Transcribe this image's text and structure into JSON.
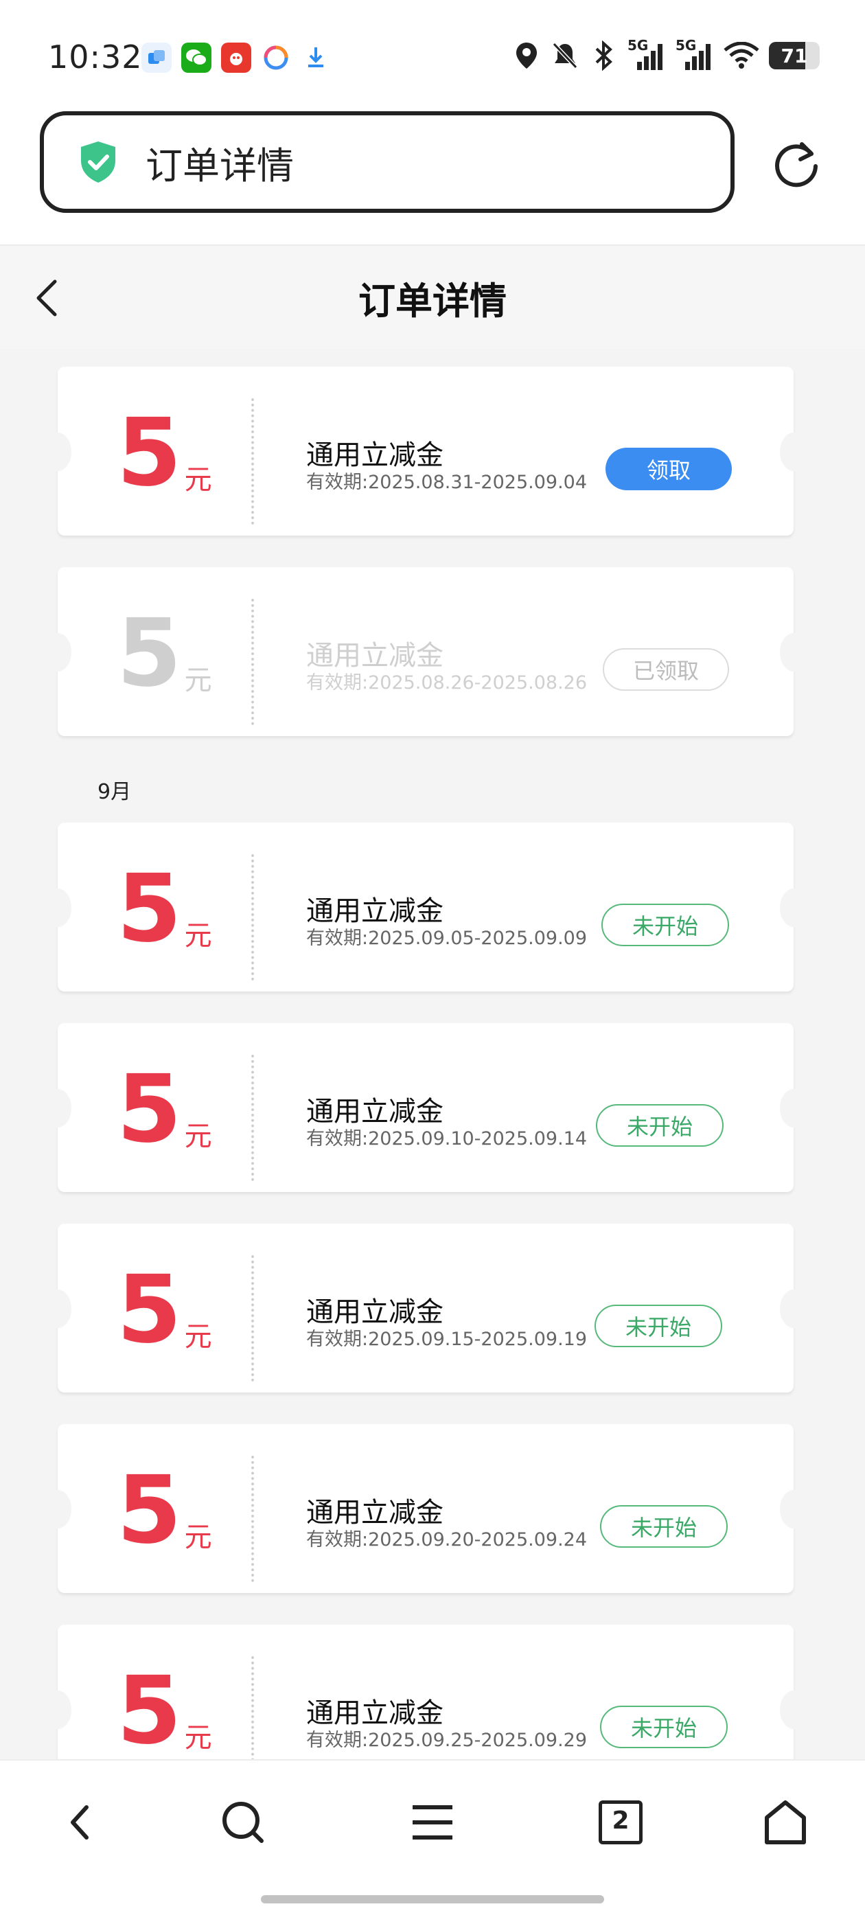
{
  "status_bar": {
    "time": "10:32",
    "network_1": "5G",
    "network_2": "5G",
    "battery_level": "71",
    "battery_fraction": 0.71
  },
  "address_bar": {
    "text": "订单详情",
    "secure_icon": "shield-check-icon",
    "shield_color": "#3cc48a",
    "reload_icon": "reload-icon"
  },
  "page": {
    "title": "订单详情",
    "back_icon": "chevron-left-icon",
    "month_label": "9月"
  },
  "coupons": [
    {
      "amount": "5",
      "unit": "元",
      "name": "通用立减金",
      "validity": "有效期:2025.08.31-2025.09.04",
      "button": "领取",
      "state": "claim"
    },
    {
      "amount": "5",
      "unit": "元",
      "name": "通用立减金",
      "validity": "有效期:2025.08.26-2025.08.26",
      "button": "已领取",
      "state": "claimed"
    },
    {
      "amount": "5",
      "unit": "元",
      "name": "通用立减金",
      "validity": "有效期:2025.09.05-2025.09.09",
      "button": "未开始",
      "state": "not-started"
    },
    {
      "amount": "5",
      "unit": "元",
      "name": "通用立减金",
      "validity": "有效期:2025.09.10-2025.09.14",
      "button": "未开始",
      "state": "not-started"
    },
    {
      "amount": "5",
      "unit": "元",
      "name": "通用立减金",
      "validity": "有效期:2025.09.15-2025.09.19",
      "button": "未开始",
      "state": "not-started"
    },
    {
      "amount": "5",
      "unit": "元",
      "name": "通用立减金",
      "validity": "有效期:2025.09.20-2025.09.24",
      "button": "未开始",
      "state": "not-started"
    },
    {
      "amount": "5",
      "unit": "元",
      "name": "通用立减金",
      "validity": "有效期:2025.09.25-2025.09.29",
      "button": "未开始",
      "state": "not-started"
    }
  ],
  "colors": {
    "amount_red": "#e83a4a",
    "claim_blue": "#3c8df1",
    "not_started_green": "#3aa866"
  },
  "bottom_nav": {
    "tab_count": "2",
    "icons": [
      "back-arrow-icon",
      "search-icon",
      "menu-icon",
      "tabs-icon",
      "home-icon"
    ]
  }
}
